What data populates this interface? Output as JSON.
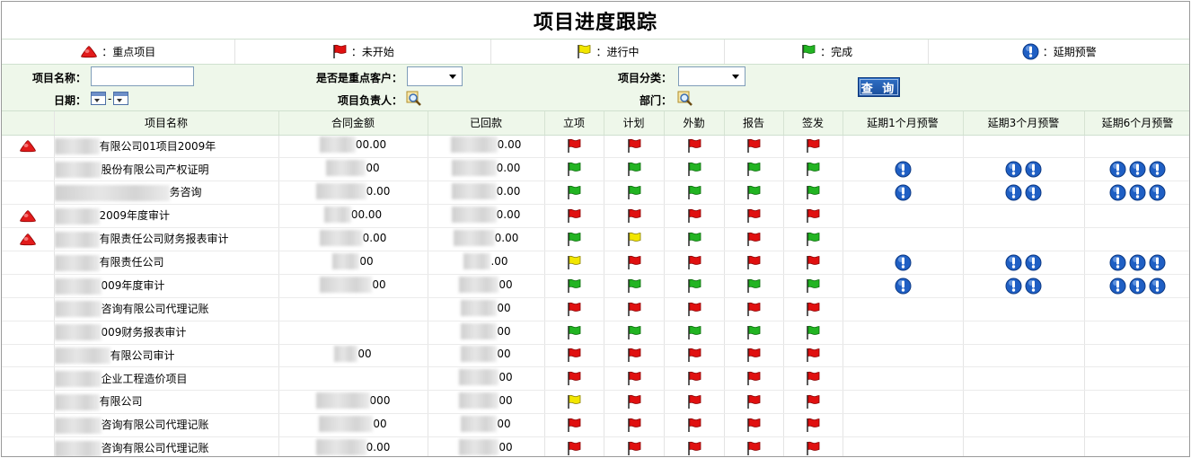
{
  "page_title": "项目进度跟踪",
  "legend": [
    {
      "icon": "red-triangle-icon",
      "text": "：重点项目"
    },
    {
      "icon": "red-flag-icon",
      "text": "：未开始"
    },
    {
      "icon": "yellow-flag-icon",
      "text": "：进行中"
    },
    {
      "icon": "green-flag-icon",
      "text": "：完成"
    },
    {
      "icon": "warning-icon",
      "text": "：延期预警"
    }
  ],
  "search": {
    "project_name_label": "项目名称：",
    "project_name_value": "",
    "key_client_label": "是否是重点客户：",
    "key_client_value": "",
    "category_label": "项目分类：",
    "category_value": "",
    "date_label": "日期：",
    "date_separator": "-",
    "owner_label": "项目负责人：",
    "dept_label": "部门：",
    "query_button": "查 询"
  },
  "table": {
    "headers": [
      "",
      "项目名称",
      "合同金额",
      "已回款",
      "立项",
      "计划",
      "外勤",
      "报告",
      "签发",
      "延期1个月预警",
      "延期3个月预警",
      "延期6个月预警"
    ],
    "rows": [
      {
        "key": true,
        "name": "有限公司01项目2009年",
        "amount": "00.00",
        "received": "0.00",
        "flags": [
          "red",
          "red",
          "red",
          "red",
          "red"
        ],
        "w1": 0,
        "w3": 0,
        "w6": 0
      },
      {
        "key": false,
        "name": "股份有限公司产权证明",
        "amount": "00",
        "received": "0.00",
        "flags": [
          "green",
          "green",
          "green",
          "green",
          "green"
        ],
        "w1": 1,
        "w3": 2,
        "w6": 3
      },
      {
        "key": false,
        "name": "务咨询",
        "amount": "0.00",
        "received": "0.00",
        "flags": [
          "green",
          "green",
          "green",
          "green",
          "green"
        ],
        "w1": 1,
        "w3": 2,
        "w6": 3
      },
      {
        "key": true,
        "name": "2009年度审计",
        "amount": "00.00",
        "received": "0.00",
        "flags": [
          "red",
          "red",
          "red",
          "red",
          "red"
        ],
        "w1": 0,
        "w3": 0,
        "w6": 0
      },
      {
        "key": true,
        "name": "有限责任公司财务报表审计",
        "amount": "0.00",
        "received": "0.00",
        "flags": [
          "green",
          "yellow",
          "green",
          "red",
          "green"
        ],
        "w1": 0,
        "w3": 0,
        "w6": 0
      },
      {
        "key": false,
        "name": "有限责任公司",
        "amount": "00",
        "received": ".00",
        "flags": [
          "yellow",
          "red",
          "red",
          "red",
          "red"
        ],
        "w1": 1,
        "w3": 2,
        "w6": 3
      },
      {
        "key": false,
        "name": "009年度审计",
        "amount": "00",
        "received": "00",
        "flags": [
          "green",
          "green",
          "green",
          "green",
          "green"
        ],
        "w1": 1,
        "w3": 2,
        "w6": 3
      },
      {
        "key": false,
        "name": "咨询有限公司代理记账",
        "amount": "",
        "received": "00",
        "flags": [
          "red",
          "red",
          "red",
          "red",
          "red"
        ],
        "w1": 0,
        "w3": 0,
        "w6": 0
      },
      {
        "key": false,
        "name": "009财务报表审计",
        "amount": "",
        "received": "00",
        "flags": [
          "green",
          "green",
          "green",
          "green",
          "green"
        ],
        "w1": 0,
        "w3": 0,
        "w6": 0
      },
      {
        "key": false,
        "name": "有限公司审计",
        "amount": "00",
        "received": "00",
        "flags": [
          "red",
          "red",
          "red",
          "red",
          "red"
        ],
        "w1": 0,
        "w3": 0,
        "w6": 0
      },
      {
        "key": false,
        "name": "企业工程造价项目",
        "amount": "",
        "received": "00",
        "flags": [
          "red",
          "red",
          "red",
          "red",
          "red"
        ],
        "w1": 0,
        "w3": 0,
        "w6": 0
      },
      {
        "key": false,
        "name": "有限公司",
        "amount": "000",
        "received": "00",
        "flags": [
          "yellow",
          "red",
          "red",
          "red",
          "red"
        ],
        "w1": 0,
        "w3": 0,
        "w6": 0
      },
      {
        "key": false,
        "name": "咨询有限公司代理记账",
        "amount": "00",
        "received": "00",
        "flags": [
          "red",
          "red",
          "red",
          "red",
          "red"
        ],
        "w1": 0,
        "w3": 0,
        "w6": 0
      },
      {
        "key": false,
        "name": "咨询有限公司代理记账",
        "amount": "0.00",
        "received": "00",
        "flags": [
          "red",
          "red",
          "red",
          "red",
          "red"
        ],
        "w1": 0,
        "w3": 0,
        "w6": 0
      }
    ]
  },
  "colors": {
    "header_bg": "#eef7ea",
    "red_flag": "#e01010",
    "yellow_flag": "#f2e600",
    "green_flag": "#22b422",
    "warning_blue": "#1f5fc4"
  }
}
